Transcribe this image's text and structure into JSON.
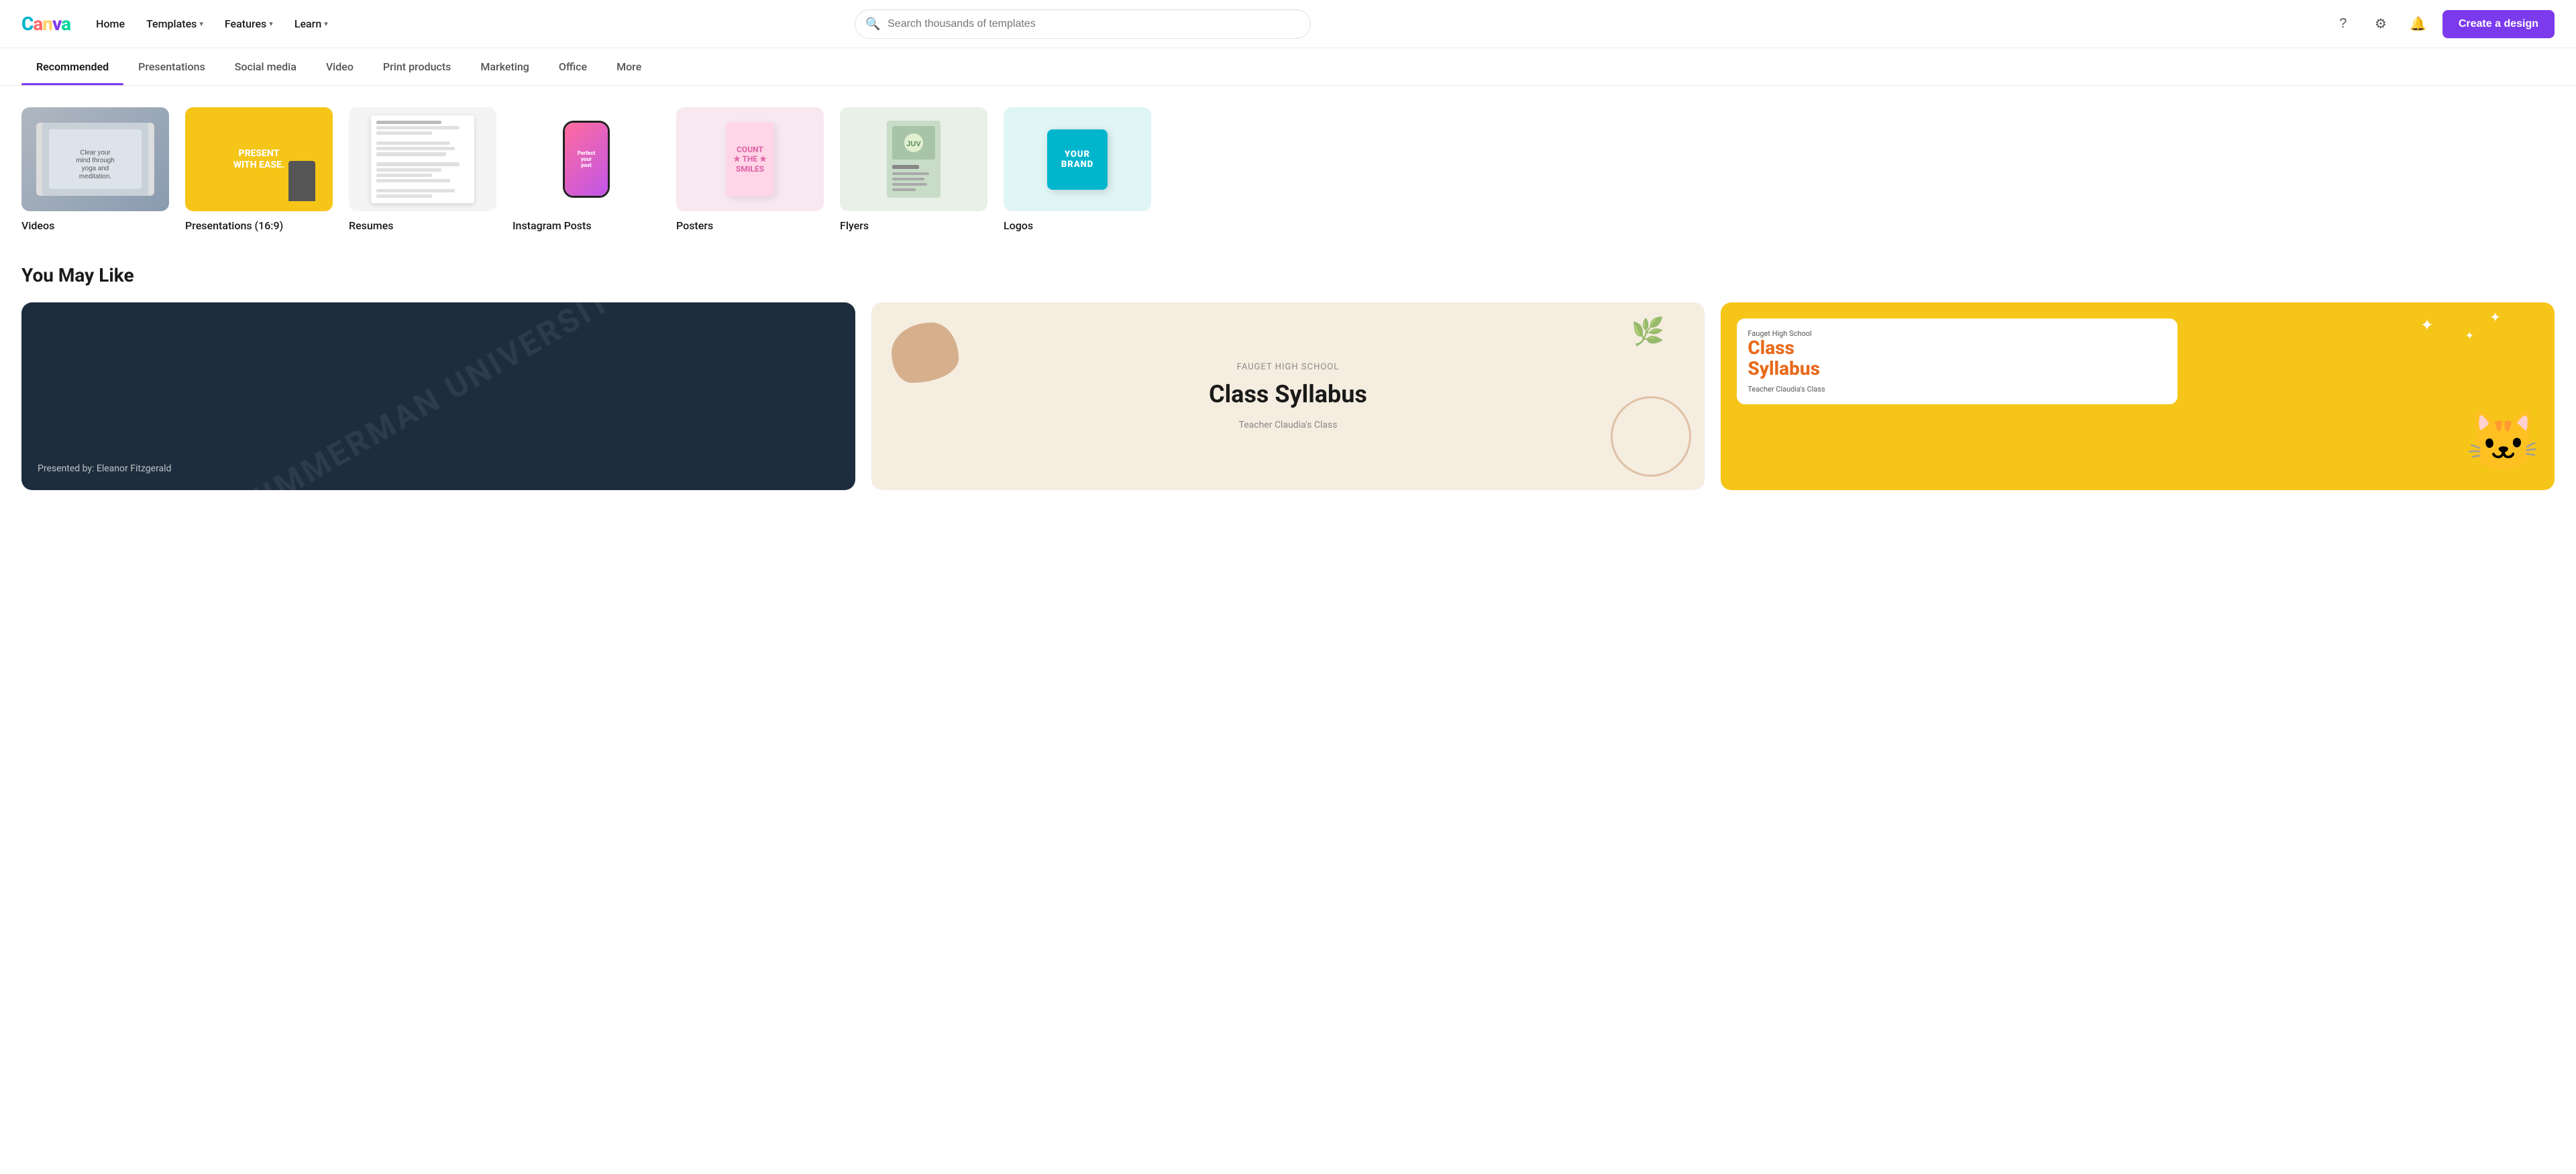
{
  "logo": {
    "text": "Canva",
    "letters": [
      "C",
      "a",
      "n",
      "v",
      "a"
    ]
  },
  "nav": {
    "items": [
      {
        "label": "Home",
        "hasDropdown": false
      },
      {
        "label": "Templates",
        "hasDropdown": true
      },
      {
        "label": "Features",
        "hasDropdown": true
      },
      {
        "label": "Learn",
        "hasDropdown": true
      }
    ]
  },
  "search": {
    "placeholder": "Search thousands of templates"
  },
  "header_actions": {
    "help_label": "?",
    "settings_label": "⚙",
    "notifications_label": "🔔",
    "create_button": "Create a design"
  },
  "tabs": [
    {
      "label": "Recommended",
      "active": true
    },
    {
      "label": "Presentations",
      "active": false
    },
    {
      "label": "Social media",
      "active": false
    },
    {
      "label": "Video",
      "active": false
    },
    {
      "label": "Print products",
      "active": false
    },
    {
      "label": "Marketing",
      "active": false
    },
    {
      "label": "Office",
      "active": false
    },
    {
      "label": "More",
      "active": false
    }
  ],
  "categories": [
    {
      "label": "Videos",
      "thumb": "videos"
    },
    {
      "label": "Presentations (16:9)",
      "thumb": "presentations"
    },
    {
      "label": "Resumes",
      "thumb": "resumes"
    },
    {
      "label": "Instagram Posts",
      "thumb": "instagram"
    },
    {
      "label": "Posters",
      "thumb": "posters"
    },
    {
      "label": "Flyers",
      "thumb": "flyers"
    },
    {
      "label": "Logos",
      "thumb": "logos"
    }
  ],
  "you_may_like": {
    "title": "You May Like",
    "cards": [
      {
        "type": "dark",
        "watermark": "ZIMMERMAN UNIVERSITY",
        "subtitle": "Presented by: Eleanor Fitzgerald"
      },
      {
        "type": "cream",
        "school": "FAUGET HIGH SCHOOL",
        "title": "Class Syllabus",
        "teacher": "Teacher Claudia's Class"
      },
      {
        "type": "yellow",
        "school": "Fauget High School",
        "title": "Class\nSyllabus",
        "teacher": "Teacher Claudia's Class"
      }
    ]
  }
}
